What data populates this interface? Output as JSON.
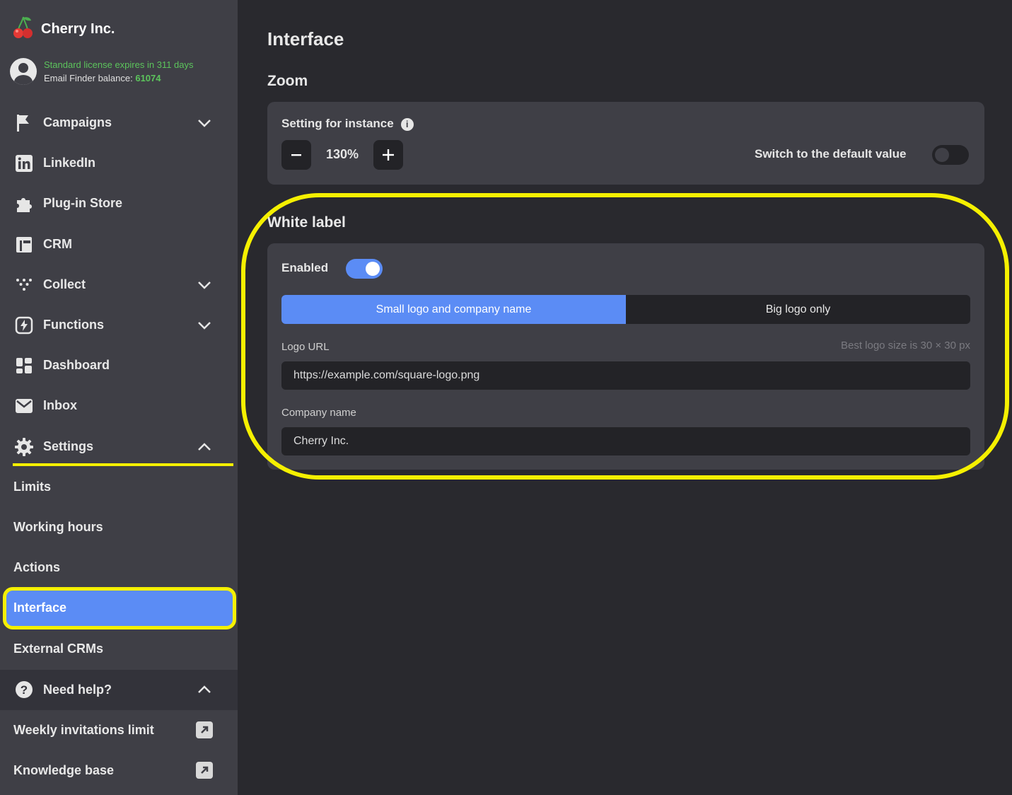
{
  "brand": {
    "name": "Cherry Inc."
  },
  "license": {
    "expiry_text": "Standard license expires in 311 days",
    "balance_label": "Email Finder balance: ",
    "balance_value": "61074"
  },
  "sidebar": {
    "items": [
      {
        "label": "Campaigns",
        "icon": "flag-icon",
        "expandable": true
      },
      {
        "label": "LinkedIn",
        "icon": "linkedin-icon",
        "expandable": false
      },
      {
        "label": "Plug-in Store",
        "icon": "puzzle-icon",
        "expandable": false
      },
      {
        "label": "CRM",
        "icon": "crm-icon",
        "expandable": false
      },
      {
        "label": "Collect",
        "icon": "collect-icon",
        "expandable": true
      },
      {
        "label": "Functions",
        "icon": "functions-icon",
        "expandable": true
      },
      {
        "label": "Dashboard",
        "icon": "dashboard-icon",
        "expandable": false
      },
      {
        "label": "Inbox",
        "icon": "mail-icon",
        "expandable": false
      },
      {
        "label": "Settings",
        "icon": "gear-icon",
        "expandable": true,
        "expanded": true
      }
    ],
    "settings_sub": [
      "Limits",
      "Working hours",
      "Actions",
      "Interface",
      "External CRMs"
    ],
    "active_sub": "Interface",
    "help": {
      "label": "Need help?"
    },
    "help_links": [
      "Weekly invitations limit",
      "Knowledge base"
    ]
  },
  "main": {
    "title": "Interface",
    "zoom": {
      "section_title": "Zoom",
      "setting_label": "Setting for instance",
      "value": "130%",
      "default_label": "Switch to the default value",
      "default_on": false
    },
    "white_label": {
      "section_title": "White label",
      "enabled_label": "Enabled",
      "enabled": true,
      "options": [
        "Small logo and company name",
        "Big logo only"
      ],
      "selected_option": "Small logo and company name",
      "logo_url_label": "Logo URL",
      "logo_hint": "Best logo size is 30 × 30 px",
      "logo_url_value": "https://example.com/square-logo.png",
      "company_name_label": "Company name",
      "company_name_value": "Cherry Inc."
    }
  },
  "colors": {
    "accent": "#5b8cf5",
    "highlight": "#f5f000",
    "license_green": "#5cc45c",
    "sidebar_bg": "#3f3f46",
    "main_bg": "#29292e"
  }
}
